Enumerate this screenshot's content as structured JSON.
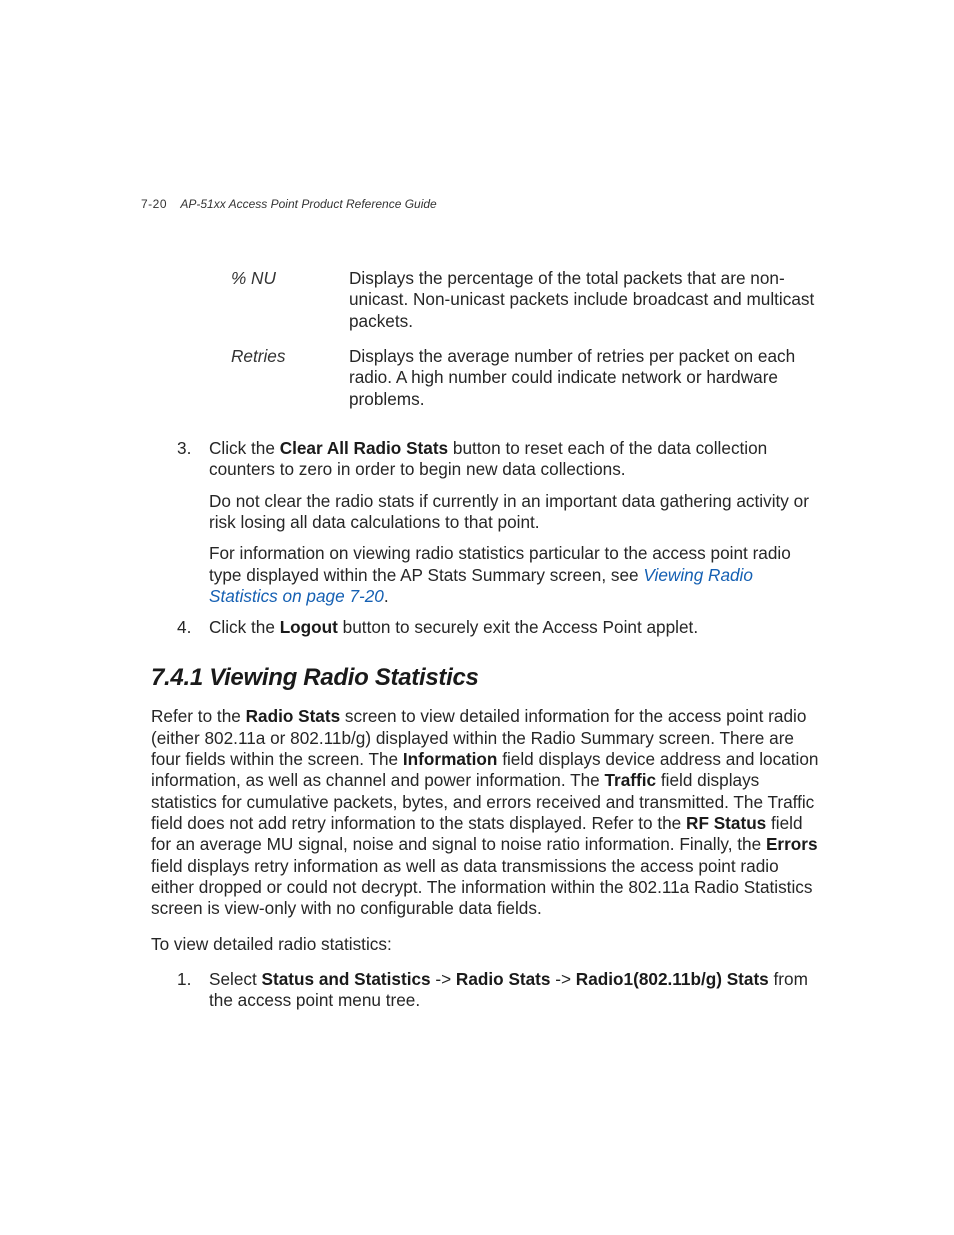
{
  "header": {
    "page_num": "7-20",
    "doc_title": "AP-51xx Access Point Product Reference Guide"
  },
  "defs": {
    "row1": {
      "term": "% NU",
      "desc": "Displays the percentage of the total packets that are non-unicast. Non-unicast packets include broadcast and multicast packets."
    },
    "row2": {
      "term": "Retries",
      "desc": "Displays the average number of retries per packet on each radio. A high number could indicate network or hardware problems."
    }
  },
  "steps": {
    "s3a_pre": "Click the ",
    "s3a_bold": "Clear All Radio Stats",
    "s3a_post": " button to reset each of the data collection counters to zero in order to begin new data collections.",
    "s3b": "Do not clear the radio stats if currently in an important data gathering activity or risk losing all data calculations to that point.",
    "s3c_pre": "For information on viewing radio statistics particular to the access point radio type displayed within the AP Stats Summary screen, see ",
    "s3c_link": "Viewing Radio Statistics on page 7-20",
    "s3c_post": ".",
    "s4_pre": "Click the ",
    "s4_bold": "Logout",
    "s4_post": " button to securely exit the Access Point applet."
  },
  "section": {
    "heading": "7.4.1 Viewing Radio Statistics",
    "p1_a": "Refer to the ",
    "p1_b": "Radio Stats",
    "p1_c": " screen to view detailed information for the access point radio (either 802.11a or 802.11b/g) displayed within the Radio Summary screen. There are four fields within the screen. The ",
    "p1_d": "Information",
    "p1_e": " field displays device address and location information, as well as channel and power information. The ",
    "p1_f": "Traffic",
    "p1_g": " field displays statistics for cumulative packets, bytes, and errors received and transmitted. The Traffic field does not add retry information to the stats displayed. Refer to the ",
    "p1_h": "RF Status",
    "p1_i": " field for an average MU signal, noise and signal to noise ratio information. Finally, the ",
    "p1_j": "Errors",
    "p1_k": " field displays retry information as well as data transmissions the access point radio either dropped or could not decrypt. The information within the 802.11a Radio Statistics screen is view-only with no configurable data fields.",
    "p2": "To view detailed radio statistics:",
    "step1_a": "Select ",
    "step1_b": "Status and Statistics",
    "step1_arrow1": " -> ",
    "step1_c": "Radio Stats",
    "step1_arrow2": " -> ",
    "step1_d": "Radio1(802.11b/g) Stats",
    "step1_e": " from the access point menu tree."
  }
}
